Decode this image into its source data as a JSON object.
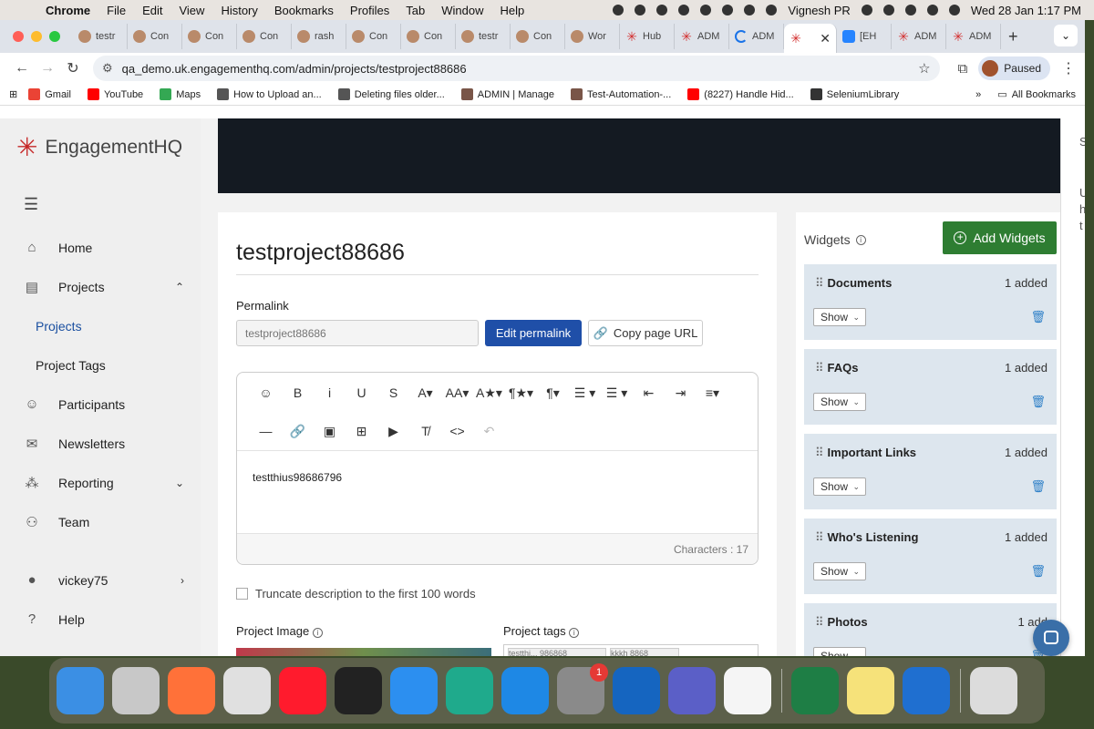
{
  "menubar": {
    "app": "Chrome",
    "items": [
      "File",
      "Edit",
      "View",
      "History",
      "Bookmarks",
      "Profiles",
      "Tab",
      "Window",
      "Help"
    ],
    "user": "Vignesh PR",
    "datetime": "Wed 28 Jan  1:17 PM"
  },
  "tabs": [
    {
      "label": "testr",
      "fav": "avatar"
    },
    {
      "label": "Con",
      "fav": "avatar"
    },
    {
      "label": "Con",
      "fav": "avatar"
    },
    {
      "label": "Con",
      "fav": "avatar"
    },
    {
      "label": "rash",
      "fav": "avatar"
    },
    {
      "label": "Con",
      "fav": "avatar"
    },
    {
      "label": "Con",
      "fav": "avatar"
    },
    {
      "label": "testr",
      "fav": "avatar"
    },
    {
      "label": "Con",
      "fav": "avatar"
    },
    {
      "label": "Wor",
      "fav": "avatar"
    },
    {
      "label": "Hub",
      "fav": "ehq"
    },
    {
      "label": "ADM",
      "fav": "ehq"
    },
    {
      "label": "ADM",
      "fav": "loading"
    }
  ],
  "active_tab": {
    "label": "",
    "close": "✕"
  },
  "tabs_after": [
    {
      "label": "[EH",
      "fav": "jira"
    },
    {
      "label": "ADM",
      "fav": "ehq"
    },
    {
      "label": "ADM",
      "fav": "ehq"
    }
  ],
  "toolbar": {
    "url": "qa_demo.uk.engagementhq.com/admin/projects/testproject88686",
    "profile_label": "Paused"
  },
  "bookmarks": [
    {
      "label": "Gmail",
      "color": "#ea4335"
    },
    {
      "label": "YouTube",
      "color": "#ff0000"
    },
    {
      "label": "Maps",
      "color": "#34a853"
    },
    {
      "label": "How to Upload an...",
      "color": "#555555"
    },
    {
      "label": "Deleting files older...",
      "color": "#555555"
    },
    {
      "label": "ADMIN | Manage",
      "color": "#795548"
    },
    {
      "label": "Test-Automation-...",
      "color": "#795548"
    },
    {
      "label": "(8227) Handle Hid...",
      "color": "#ff0000"
    },
    {
      "label": "SeleniumLibrary",
      "color": "#333333"
    }
  ],
  "bookmarks_all": "All Bookmarks",
  "sidebar": {
    "brand": "EngagementHQ",
    "items": [
      {
        "label": "Home",
        "icon": "home-icon"
      },
      {
        "label": "Projects",
        "icon": "projects-icon",
        "caret": "⌃"
      },
      {
        "label": "Participants",
        "icon": "participants-icon"
      },
      {
        "label": "Newsletters",
        "icon": "mail-icon"
      },
      {
        "label": "Reporting",
        "icon": "reporting-icon",
        "caret": "⌄"
      },
      {
        "label": "Team",
        "icon": "team-icon"
      },
      {
        "label": "vickey75",
        "icon": "user-icon",
        "caret": "›"
      },
      {
        "label": "Help",
        "icon": "help-icon"
      }
    ],
    "sub": [
      "Projects",
      "Project Tags"
    ]
  },
  "project": {
    "title": "testproject88686",
    "permalink_label": "Permalink",
    "permalink_placeholder": "testproject88686",
    "edit_permalink": "Edit permalink",
    "copy_url": "Copy page URL",
    "description": "testthius98686796",
    "char_count": "Characters : 17",
    "truncate_label": "Truncate description to the first 100 words",
    "image_label": "Project Image",
    "tags_label": "Project tags",
    "tags": [
      "testthi... 986868",
      "kkkh 8868"
    ]
  },
  "editor_toolbar": {
    "row1": [
      "☺",
      "B",
      "i",
      "U",
      "S",
      "A▾",
      "AA▾",
      "A★▾",
      "¶★▾",
      "¶▾",
      "☰ ▾",
      "☰ ▾",
      "⇤",
      "⇥",
      "≡▾"
    ],
    "row2": [
      "—",
      "🔗",
      "▣",
      "⊞",
      "▶",
      "T̸",
      "<>",
      "↶"
    ]
  },
  "widgets": {
    "title": "Widgets",
    "add_button": "Add Widgets",
    "items": [
      {
        "name": "Documents",
        "count": "1 added",
        "show": "Show"
      },
      {
        "name": "FAQs",
        "count": "1 added",
        "show": "Show"
      },
      {
        "name": "Important Links",
        "count": "1 added",
        "show": "Show"
      },
      {
        "name": "Who's Listening",
        "count": "1 added",
        "show": "Show"
      },
      {
        "name": "Photos",
        "count": "1 add",
        "show": "Show"
      }
    ]
  },
  "right_panel": [
    "S",
    "U",
    "h",
    "t"
  ],
  "dock": [
    {
      "name": "finder",
      "color": "#3b8fe4"
    },
    {
      "name": "launchpad",
      "color": "#c8c8c8"
    },
    {
      "name": "firefox",
      "color": "#ff7139"
    },
    {
      "name": "chrome",
      "color": "#e0e0e0"
    },
    {
      "name": "opera",
      "color": "#ff1b2d"
    },
    {
      "name": "terminal",
      "color": "#222222"
    },
    {
      "name": "safari",
      "color": "#2c8ff0"
    },
    {
      "name": "edge",
      "color": "#1faa8c"
    },
    {
      "name": "app-store",
      "color": "#1e88e5"
    },
    {
      "name": "system-settings",
      "color": "#8a8a8a",
      "badge": "1"
    },
    {
      "name": "outlook",
      "color": "#1565c0"
    },
    {
      "name": "teams",
      "color": "#5b5fc7"
    },
    {
      "name": "freeform",
      "color": "#f5f5f5"
    },
    {
      "name": "excel",
      "color": "#1e7e45"
    },
    {
      "name": "notes",
      "color": "#f6e27a"
    },
    {
      "name": "vscode",
      "color": "#1f6fd0"
    },
    {
      "name": "trash",
      "color": "#dcdcdc"
    }
  ]
}
